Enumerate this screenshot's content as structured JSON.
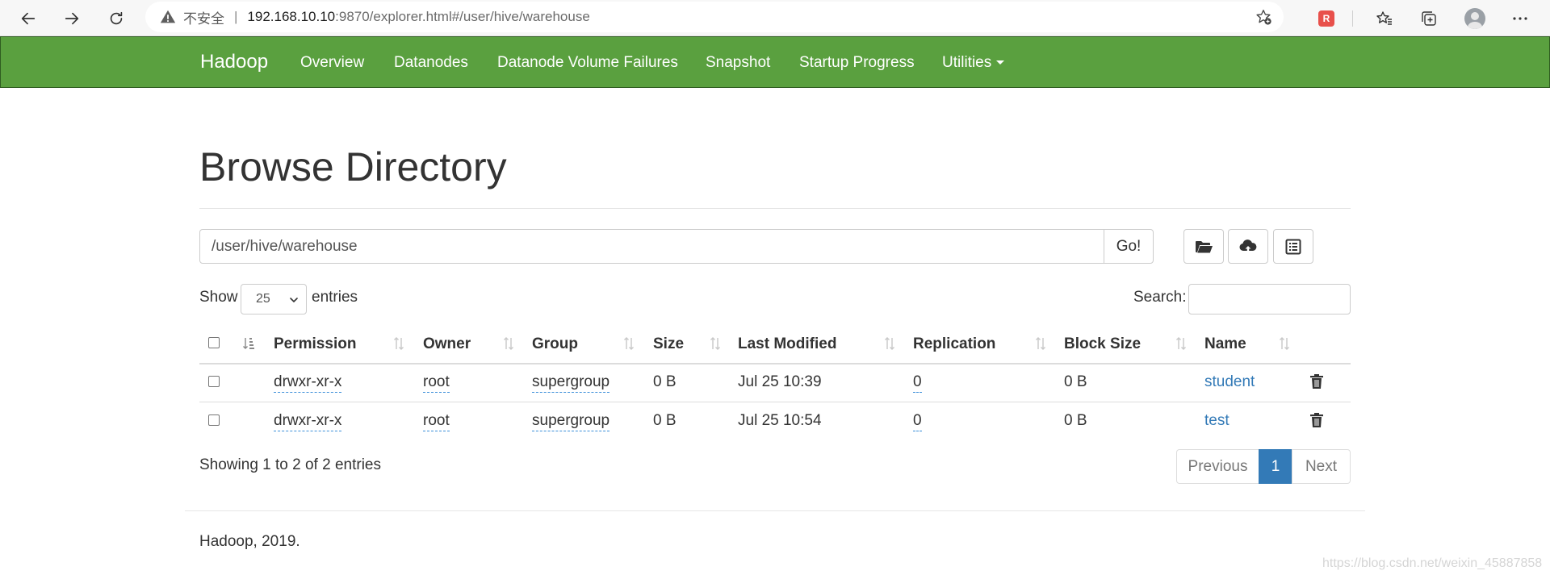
{
  "browser": {
    "insecure_label": "不安全",
    "address_host": "192.168.10.10",
    "address_rest": ":9870/explorer.html#/user/hive/warehouse",
    "extension_label": "R"
  },
  "navbar": {
    "brand": "Hadoop",
    "items": [
      "Overview",
      "Datanodes",
      "Datanode Volume Failures",
      "Snapshot",
      "Startup Progress",
      "Utilities"
    ],
    "background": "#5aa03f"
  },
  "page": {
    "title": "Browse Directory",
    "path_value": "/user/hive/warehouse",
    "go_label": "Go!",
    "show_label": "Show",
    "page_length": "25",
    "entries_label": "entries",
    "search_label": "Search:"
  },
  "table": {
    "headers": [
      "Permission",
      "Owner",
      "Group",
      "Size",
      "Last Modified",
      "Replication",
      "Block Size",
      "Name"
    ],
    "rows": [
      {
        "permission": "drwxr-xr-x",
        "owner": "root",
        "group": "supergroup",
        "size": "0 B",
        "modified": "Jul 25 10:39",
        "replication": "0",
        "block_size": "0 B",
        "name": "student"
      },
      {
        "permission": "drwxr-xr-x",
        "owner": "root",
        "group": "supergroup",
        "size": "0 B",
        "modified": "Jul 25 10:54",
        "replication": "0",
        "block_size": "0 B",
        "name": "test"
      }
    ],
    "info": "Showing 1 to 2 of 2 entries"
  },
  "pagination": {
    "previous": "Previous",
    "current": "1",
    "next": "Next",
    "active_color": "#337ab7"
  },
  "footer": {
    "text": "Hadoop, 2019.",
    "watermark": "https://blog.csdn.net/weixin_45887858"
  },
  "icons": [
    "back-icon",
    "forward-icon",
    "refresh-icon",
    "warning-icon",
    "favorite-add-icon",
    "favorites-icon",
    "collections-icon",
    "more-icon",
    "folder-open-icon",
    "cloud-upload-icon",
    "list-alt-icon",
    "sort-icon",
    "trash-icon"
  ]
}
